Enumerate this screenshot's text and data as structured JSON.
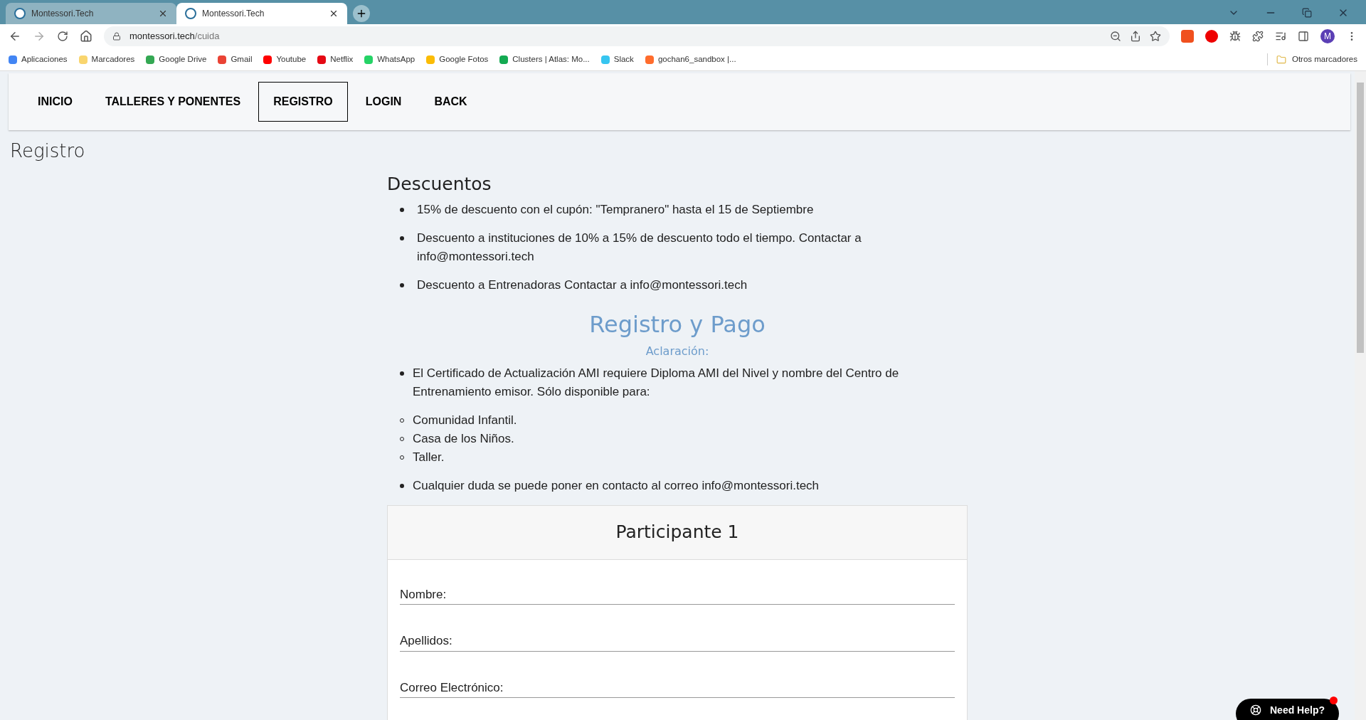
{
  "browser": {
    "tabs": [
      {
        "title": "Montessori.Tech",
        "selected": false
      },
      {
        "title": "Montessori.Tech",
        "selected": true
      }
    ],
    "address": {
      "host": "montessori.tech",
      "path": "/cuida"
    },
    "profile_initial": "M",
    "bookmarks": [
      {
        "label": "Aplicaciones",
        "color": "#4285f4"
      },
      {
        "label": "Marcadores",
        "color": "#f9d56e"
      },
      {
        "label": "Google Drive",
        "color": "#34a853"
      },
      {
        "label": "Gmail",
        "color": "#ea4335"
      },
      {
        "label": "Youtube",
        "color": "#ff0000"
      },
      {
        "label": "Netflix",
        "color": "#e50914"
      },
      {
        "label": "WhatsApp",
        "color": "#25d366"
      },
      {
        "label": "Google Fotos",
        "color": "#fbbc05"
      },
      {
        "label": "Clusters | Atlas: Mo...",
        "color": "#13aa52"
      },
      {
        "label": "Slack",
        "color": "#36c5f0"
      },
      {
        "label": "gochan6_sandbox |...",
        "color": "#ff6c2c"
      }
    ],
    "other_bookmarks": "Otros marcadores"
  },
  "nav": [
    {
      "label": "INICIO",
      "selected": false
    },
    {
      "label": "TALLERES Y PONENTES",
      "selected": false
    },
    {
      "label": "REGISTRO",
      "selected": true
    },
    {
      "label": "LOGIN",
      "selected": false
    },
    {
      "label": "BACK",
      "selected": false
    }
  ],
  "page_title": "Registro",
  "discounts": {
    "heading": "Descuentos",
    "items": [
      "15% de descuento con el cupón: \"Tempranero\" hasta el 15 de Septiembre",
      "Descuento a instituciones de 10% a 15% de descuento todo el tiempo. Contactar a info@montessori.tech",
      "Descuento a Entrenadoras Contactar a info@montessori.tech"
    ]
  },
  "registration": {
    "heading": "Registro y Pago",
    "subheading": "Aclaración:",
    "items": [
      {
        "kind": "bullet",
        "text": "El Certificado de Actualización AMI requiere Diploma AMI del Nivel y nombre del Centro de Entrenamiento emisor. Sólo disponible para:"
      },
      {
        "kind": "circle",
        "text": "Comunidad Infantil."
      },
      {
        "kind": "circle",
        "text": "Casa de los Niños."
      },
      {
        "kind": "circle",
        "text": "Taller."
      },
      {
        "kind": "bullet",
        "text": "Cualquier duda se puede poner en contacto al correo info@montessori.tech"
      }
    ]
  },
  "participant": {
    "title": "Participante 1",
    "fields": [
      {
        "label": "Nombre:"
      },
      {
        "label": "Apellidos:"
      },
      {
        "label": "Correo Electrónico:"
      }
    ]
  },
  "help_button": {
    "label": "Need Help?",
    "notification": true
  }
}
